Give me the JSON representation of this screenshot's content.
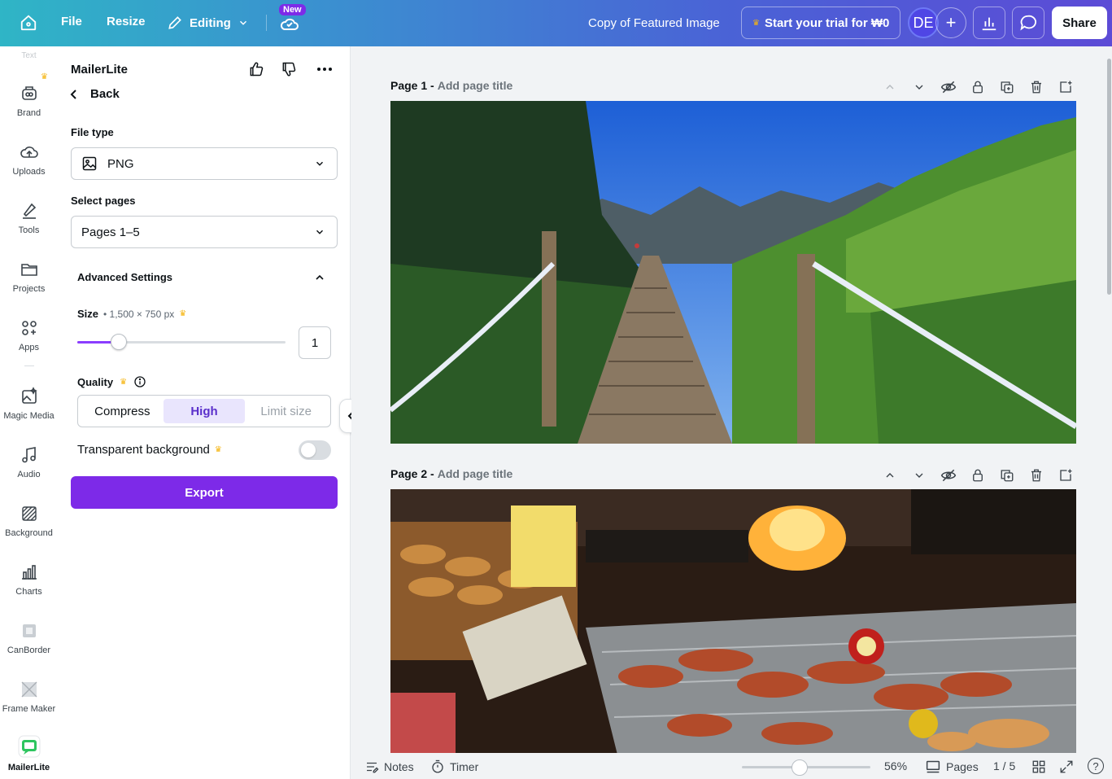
{
  "topbar": {
    "file_label": "File",
    "resize_label": "Resize",
    "editing_label": "Editing",
    "new_badge": "New",
    "doc_title": "Copy of Featured Image",
    "trial_label": "Start your trial for ₩0",
    "avatar_initials": "DE",
    "plus_label": "+",
    "share_label": "Share"
  },
  "rail": {
    "top_text": "Text",
    "items": [
      {
        "label": "Brand",
        "icon": "brand-icon"
      },
      {
        "label": "Uploads",
        "icon": "upload-cloud-icon"
      },
      {
        "label": "Tools",
        "icon": "pen-tool-icon"
      },
      {
        "label": "Projects",
        "icon": "folder-icon"
      },
      {
        "label": "Apps",
        "icon": "apps-grid-icon"
      },
      {
        "label": "Magic Media",
        "icon": "magic-image-icon"
      },
      {
        "label": "Audio",
        "icon": "music-note-icon"
      },
      {
        "label": "Background",
        "icon": "background-hatch-icon"
      },
      {
        "label": "Charts",
        "icon": "bar-chart-icon"
      },
      {
        "label": "CanBorder",
        "icon": "border-app-icon"
      },
      {
        "label": "Frame Maker",
        "icon": "frame-app-icon"
      },
      {
        "label": "MailerLite",
        "icon": "mailerlite-app-icon"
      }
    ]
  },
  "panel": {
    "app_title": "MailerLite",
    "back_label": "Back",
    "file_type_label": "File type",
    "file_type_value": "PNG",
    "select_pages_label": "Select pages",
    "select_pages_value": "Pages 1–5",
    "advanced_label": "Advanced Settings",
    "size_label": "Size",
    "size_sub": "• 1,500 × 750 px",
    "size_value": "1",
    "size_slider_fraction": 0.2,
    "quality_label": "Quality",
    "quality_options": [
      "Compress",
      "High",
      "Limit size"
    ],
    "quality_selected": "High",
    "transparent_label": "Transparent background",
    "transparent_on": false,
    "export_label": "Export"
  },
  "pages": [
    {
      "number_label": "Page 1 -",
      "title_placeholder": "Add page title"
    },
    {
      "number_label": "Page 2 -",
      "title_placeholder": "Add page title"
    }
  ],
  "bottombar": {
    "notes_label": "Notes",
    "timer_label": "Timer",
    "zoom_label": "56%",
    "zoom_fraction": 0.45,
    "pages_label": "Pages",
    "page_counter": "1 / 5",
    "help_label": "?"
  },
  "colors": {
    "accent": "#7d2ae8",
    "selected_bg": "#e9e5fd",
    "crown": "#f5b40f"
  }
}
